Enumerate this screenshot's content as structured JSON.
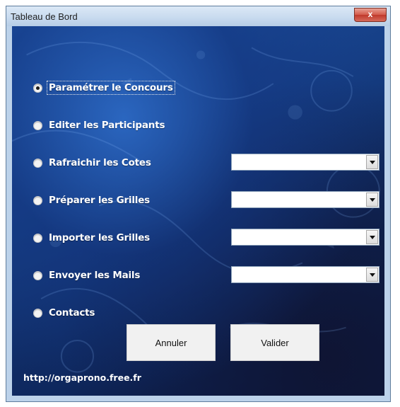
{
  "window": {
    "title": "Tableau de Bord",
    "close_label": "x"
  },
  "options": [
    {
      "label": "Paramétrer le Concours",
      "checked": true
    },
    {
      "label": "Editer les Participants",
      "checked": false
    },
    {
      "label": "Rafraichir les Cotes",
      "checked": false
    },
    {
      "label": "Préparer les Grilles",
      "checked": false
    },
    {
      "label": "Importer les Grilles",
      "checked": false
    },
    {
      "label": "Envoyer les Mails",
      "checked": false
    },
    {
      "label": "Contacts",
      "checked": false
    }
  ],
  "combos": [
    {
      "value": ""
    },
    {
      "value": ""
    },
    {
      "value": ""
    },
    {
      "value": ""
    }
  ],
  "buttons": {
    "cancel": "Annuler",
    "validate": "Valider"
  },
  "footer": {
    "url": "http://orgaprono.free.fr"
  },
  "colors": {
    "accent": "#1f55a8",
    "background_dark": "#0b1a45",
    "text_light": "#ffffff",
    "close_button": "#c0392b"
  }
}
